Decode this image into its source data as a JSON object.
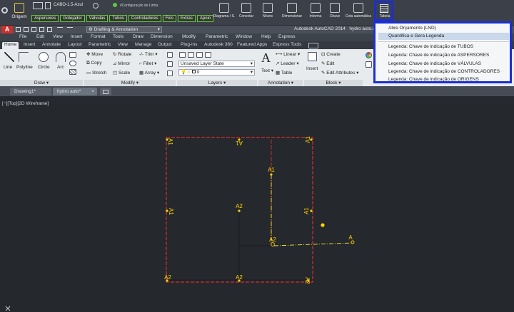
{
  "plugin_bar": {
    "origem_label": "Origem",
    "cabo_label": "CABO-1.5-Azul",
    "config_label": "#Configuração de Linha",
    "tags": [
      "Aspersores",
      "Gotejador",
      "Válvulas",
      "Tubos",
      "Controladores",
      "Fios",
      "Extras",
      "Apoio"
    ],
    "diagrama_label": "Diagrama / S.",
    "conectar_label": "Conectar",
    "niveis_label": "Níveis",
    "dimensionar_label": "Dimensionar",
    "informa_label": "Informa",
    "chave_label": "Chave",
    "cota_label": "Cota automática",
    "tabelas_label": "Tabela"
  },
  "titlebar": {
    "workspace": "Drafting & Annotation",
    "app_title": "Autodesk AutoCAD 2014",
    "file_name": "hydro auto.dwg"
  },
  "menubar": [
    "File",
    "Edit",
    "View",
    "Insert",
    "Format",
    "Tools",
    "Draw",
    "Dimension",
    "Modify",
    "Parametric",
    "Window",
    "Help",
    "Express"
  ],
  "ribbon_tabs": [
    "Home",
    "Insert",
    "Annotate",
    "Layout",
    "Parametric",
    "View",
    "Manage",
    "Output",
    "Plug-ins",
    "Autodesk 360",
    "Featured Apps",
    "Express Tools"
  ],
  "ribbon": {
    "draw": {
      "panel": "Draw",
      "line": "Line",
      "polyline": "Polyline",
      "circle": "Circle",
      "arc": "Arc"
    },
    "modify": {
      "panel": "Modify",
      "move": "Move",
      "rotate": "Rotate",
      "trim": "Trim",
      "copy": "Copy",
      "mirror": "Mirror",
      "fillet": "Fillet",
      "stretch": "Stretch",
      "scale": "Scale",
      "array": "Array"
    },
    "layers": {
      "panel": "Layers",
      "state": "Unsaved Layer State",
      "current": "0"
    },
    "annotation": {
      "panel": "Annotation",
      "text": "Text",
      "linear": "Linear",
      "leader": "Leader",
      "table": "Table"
    },
    "block": {
      "panel": "Block",
      "insert": "Insert",
      "create": "Create",
      "edit": "Edit",
      "edit_attributes": "Edit Attributes"
    }
  },
  "doc_tabs": [
    "Drawing1*",
    "hydro auto*"
  ],
  "viewport_label": "[−][Top][2D Wireframe]",
  "dropdown": {
    "items": [
      "Abre Orçamento (LND)",
      "Quantifica e Gera Legenda",
      "Legenda: Chave de indicação de TUBOS",
      "Legenda: Chave de indicação de ASPERSORES",
      "Legenda: Chave de indicação de VÁLVULAS",
      "Legenda: Chave de indicação de CONTROLADORES",
      "Legenda: Chave de indicação de ORIGENS"
    ],
    "highlighted_index": 1
  },
  "drawing_labels": {
    "a1": "A1",
    "a2": "A2",
    "a": "A"
  },
  "colors": {
    "rectangle": "#ff3030",
    "inner_line": "#ff2d2d",
    "centerline": "#f5ef32",
    "marker": "#ffd400",
    "highlight_border": "#1b2fd1"
  }
}
